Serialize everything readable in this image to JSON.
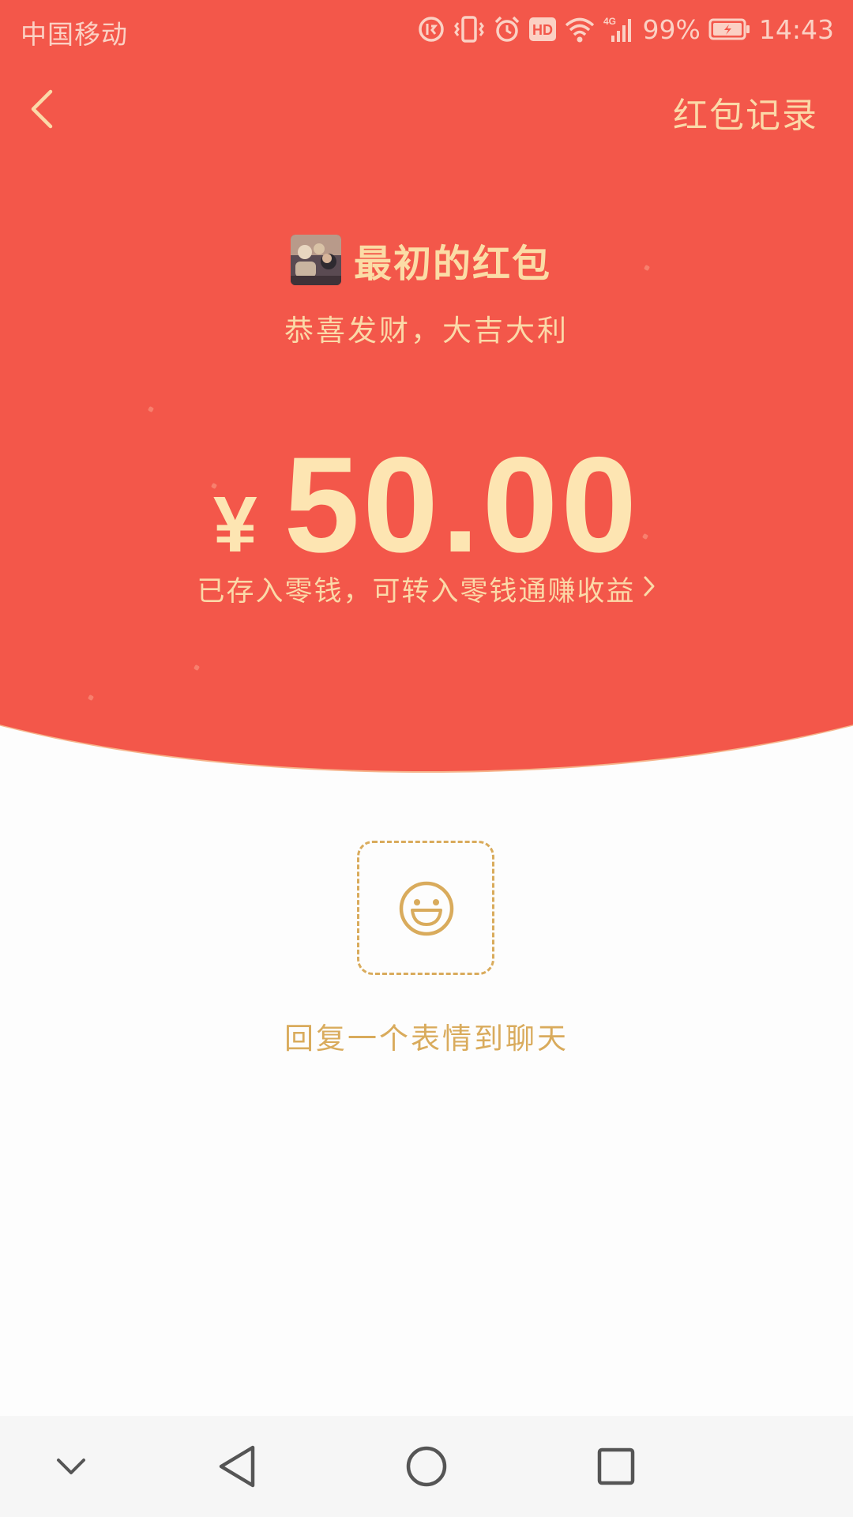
{
  "status_bar": {
    "carrier": "中国移动",
    "network_type": "4G",
    "battery": "99%",
    "time": "14:43",
    "hd_badge": "HD"
  },
  "nav": {
    "records_label": "红包记录"
  },
  "packet": {
    "sender": "最初的红包",
    "blessing": "恭喜发财，大吉大利",
    "currency": "¥",
    "amount": "50.00",
    "stored_note": "已存入零钱，可转入零钱通赚收益",
    "reply_label": "回复一个表情到聊天"
  },
  "icons": {
    "back": "chevron-left-icon",
    "note_arrow": "chevron-right-icon",
    "emoji": "smiley-icon",
    "nav_down": "chevron-down-icon",
    "nav_back": "triangle-back-icon",
    "nav_home": "circle-home-icon",
    "nav_recents": "square-recents-icon"
  },
  "colors": {
    "header_red": "#f3574a",
    "gold_text": "#fbd9a8",
    "amount_text": "#fde5b2",
    "reply_gold": "#d9ab5c",
    "background": "#fdfdfd"
  }
}
